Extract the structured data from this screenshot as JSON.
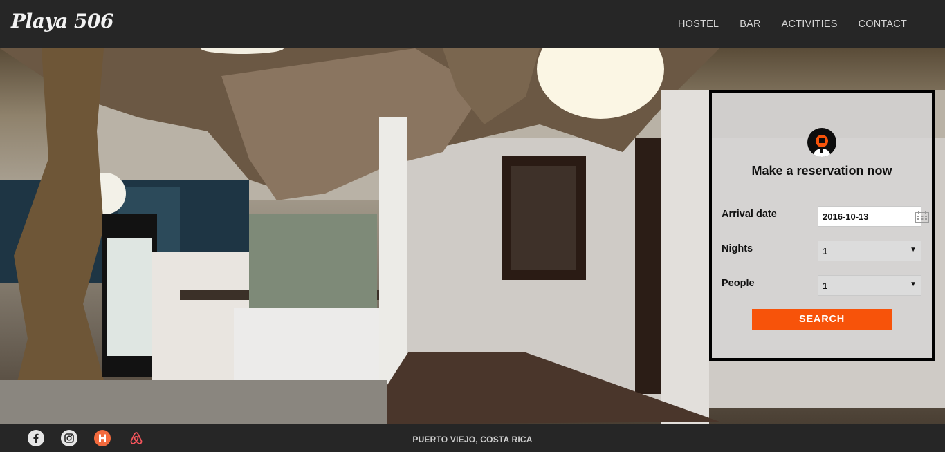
{
  "brand": {
    "logo_text": "Playa 506"
  },
  "nav": {
    "items": [
      {
        "label": "HOSTEL"
      },
      {
        "label": "BAR"
      },
      {
        "label": "ACTIVITIES"
      },
      {
        "label": "CONTACT"
      }
    ]
  },
  "reservation": {
    "title": "Make a reservation now",
    "arrival_label": "Arrival date",
    "arrival_value": "2016-10-13",
    "nights_label": "Nights",
    "nights_value": "1",
    "people_label": "People",
    "people_value": "1",
    "search_label": "SEARCH"
  },
  "footer": {
    "location": "PUERTO VIEJO, COSTA RICA",
    "social_icons": [
      "facebook-icon",
      "instagram-icon",
      "hostelworld-icon",
      "airbnb-icon"
    ]
  },
  "colors": {
    "accent": "#f7530a",
    "header_bg": "#262626",
    "airbnb": "#f2545b"
  }
}
